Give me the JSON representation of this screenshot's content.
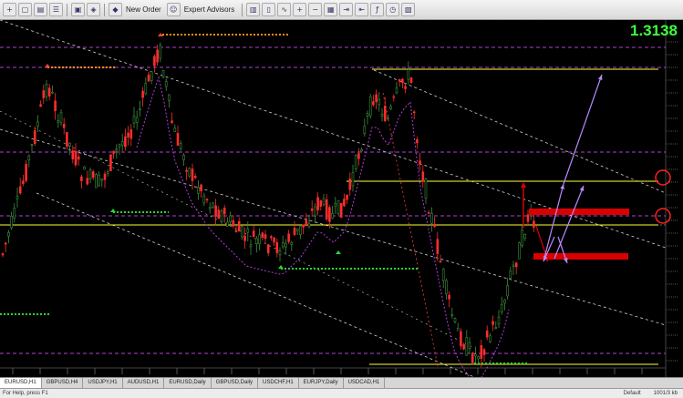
{
  "toolbar": {
    "buttons": [
      "new-chart",
      "open",
      "profiles",
      "navigator",
      "terminal",
      "tester"
    ],
    "new_order_label": "New Order",
    "expert_label": "Expert Advisors"
  },
  "chart": {
    "current_price": "1.3138",
    "colors": {
      "bull_candle": "#3d8f3d",
      "bear_candle": "#ff2d2d",
      "channel_line": "#7a7a7a",
      "support_resistance": "#ffff33",
      "purple_level": "#b03fd6",
      "green_dots": "#2bd52b",
      "red_dots": "#ff4040",
      "orange_dots": "#ff8c1a",
      "arrow_violet": "#b88bff",
      "red_box": "#d90000"
    }
  },
  "tabs": {
    "items": [
      "EURUSD,H1",
      "GBPUSD,H4",
      "USDJPY,H1",
      "AUDUSD,H1",
      "EURUSD,Daily",
      "GBPUSD,Daily",
      "USDCHF,H1",
      "EURJPY,Daily",
      "USDCAD,H1"
    ],
    "active_index": 0
  },
  "status": {
    "left": "For Help, press F1",
    "right": [
      "Default",
      "1001/3 kb"
    ]
  }
}
